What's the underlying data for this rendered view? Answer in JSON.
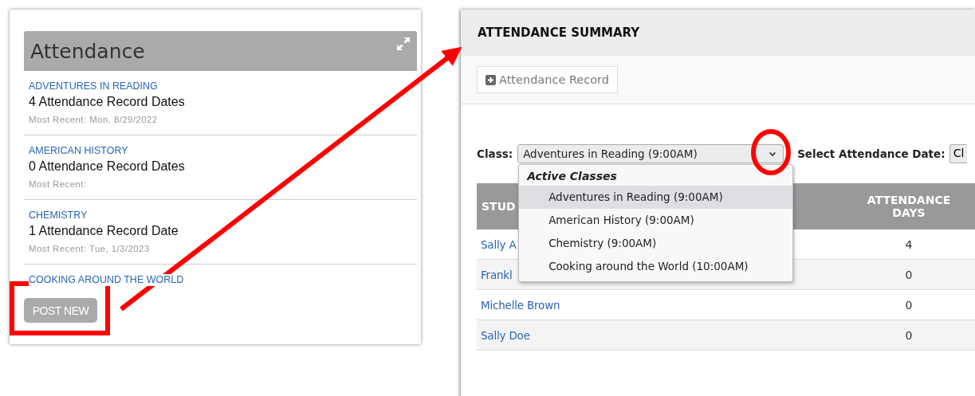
{
  "attendance_widget": {
    "title": "Attendance",
    "classes": [
      {
        "name": "ADVENTURES IN READING",
        "count": "4 Attendance Record Dates",
        "most_recent": "Most Recent: Mon, 8/29/2022"
      },
      {
        "name": "AMERICAN HISTORY",
        "count": "0 Attendance Record Dates",
        "most_recent": "Most Recent:"
      },
      {
        "name": "CHEMISTRY",
        "count": "1 Attendance Record Date",
        "most_recent": "Most Recent: Tue, 1/3/2023"
      },
      {
        "name": "COOKING AROUND THE WORLD"
      }
    ],
    "post_button": "POST NEW"
  },
  "summary": {
    "title": "ATTENDANCE SUMMARY",
    "add_button": "Attendance Record",
    "class_label": "Class:",
    "class_value": "Adventures in Reading (9:00AM)",
    "date_label": "Select Attendance Date:",
    "date_value": "Cl",
    "dropdown": {
      "group": "Active Classes",
      "options": [
        {
          "label": "Adventures in Reading (9:00AM)",
          "selected": true
        },
        {
          "label": "American History (9:00AM)",
          "selected": false
        },
        {
          "label": "Chemistry (9:00AM)",
          "selected": false
        },
        {
          "label": "Cooking around the World (10:00AM)",
          "selected": false
        }
      ]
    },
    "table": {
      "columns": [
        "STUD",
        "ATTENDANCE DAYS"
      ],
      "rows": [
        {
          "student": "Sally A",
          "days": "4"
        },
        {
          "student": "Frankl",
          "days": "0"
        },
        {
          "student": "Michelle Brown",
          "days": "0"
        },
        {
          "student": "Sally Doe",
          "days": "0"
        }
      ]
    }
  }
}
